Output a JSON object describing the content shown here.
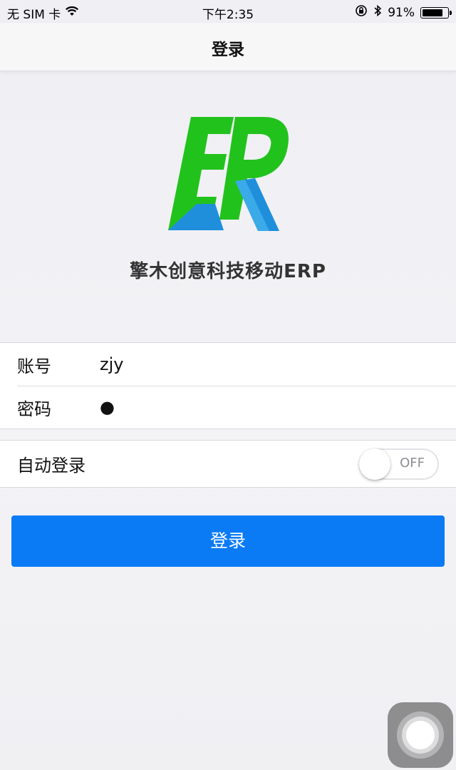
{
  "status_bar": {
    "carrier": "无 SIM 卡",
    "time": "下午2:35",
    "battery_percent": "91%",
    "battery_level": 0.91
  },
  "nav": {
    "title": "登录"
  },
  "brand": {
    "name": "擎木创意科技移动ERP",
    "colors": {
      "green": "#22c21c",
      "blue": "#1f8fdc",
      "light_blue": "#4bb9ef"
    }
  },
  "form": {
    "account_label": "账号",
    "account_value": "zjy",
    "password_label": "密码",
    "password_value": "●"
  },
  "auto_login": {
    "label": "自动登录",
    "state": "OFF"
  },
  "login_button": {
    "label": "登录",
    "color": "#0a7bf5"
  }
}
